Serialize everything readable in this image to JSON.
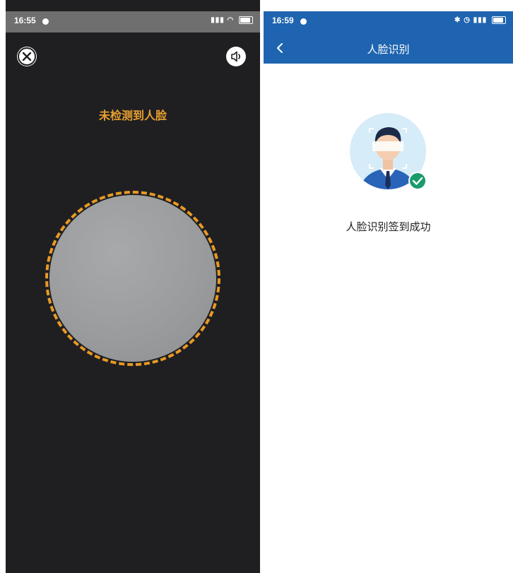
{
  "left_screen": {
    "status_bar": {
      "time": "16:55",
      "indicators": "??? ?? ?? ?? ??",
      "icons": [
        "wifi-icon",
        "signal-icon",
        "battery-icon"
      ]
    },
    "close_icon": "close-icon",
    "sound_icon": "speaker-icon",
    "prompt": "未检测到人脸",
    "colors": {
      "background": "#1f1f22",
      "accent": "#e89a24",
      "prompt": "#e8a030"
    }
  },
  "right_screen": {
    "status_bar": {
      "time": "16:59",
      "indicators": "?? ?? ?? ??",
      "icons": [
        "bluetooth-icon",
        "alarm-icon",
        "signal-icon",
        "battery-icon"
      ]
    },
    "nav": {
      "back_icon": "chevron-left-icon",
      "title": "人脸识别"
    },
    "avatar_icon": "face-verified-icon",
    "success_text": "人脸识别签到成功",
    "colors": {
      "header": "#1f64b0",
      "check": "#1a9b6c"
    }
  }
}
